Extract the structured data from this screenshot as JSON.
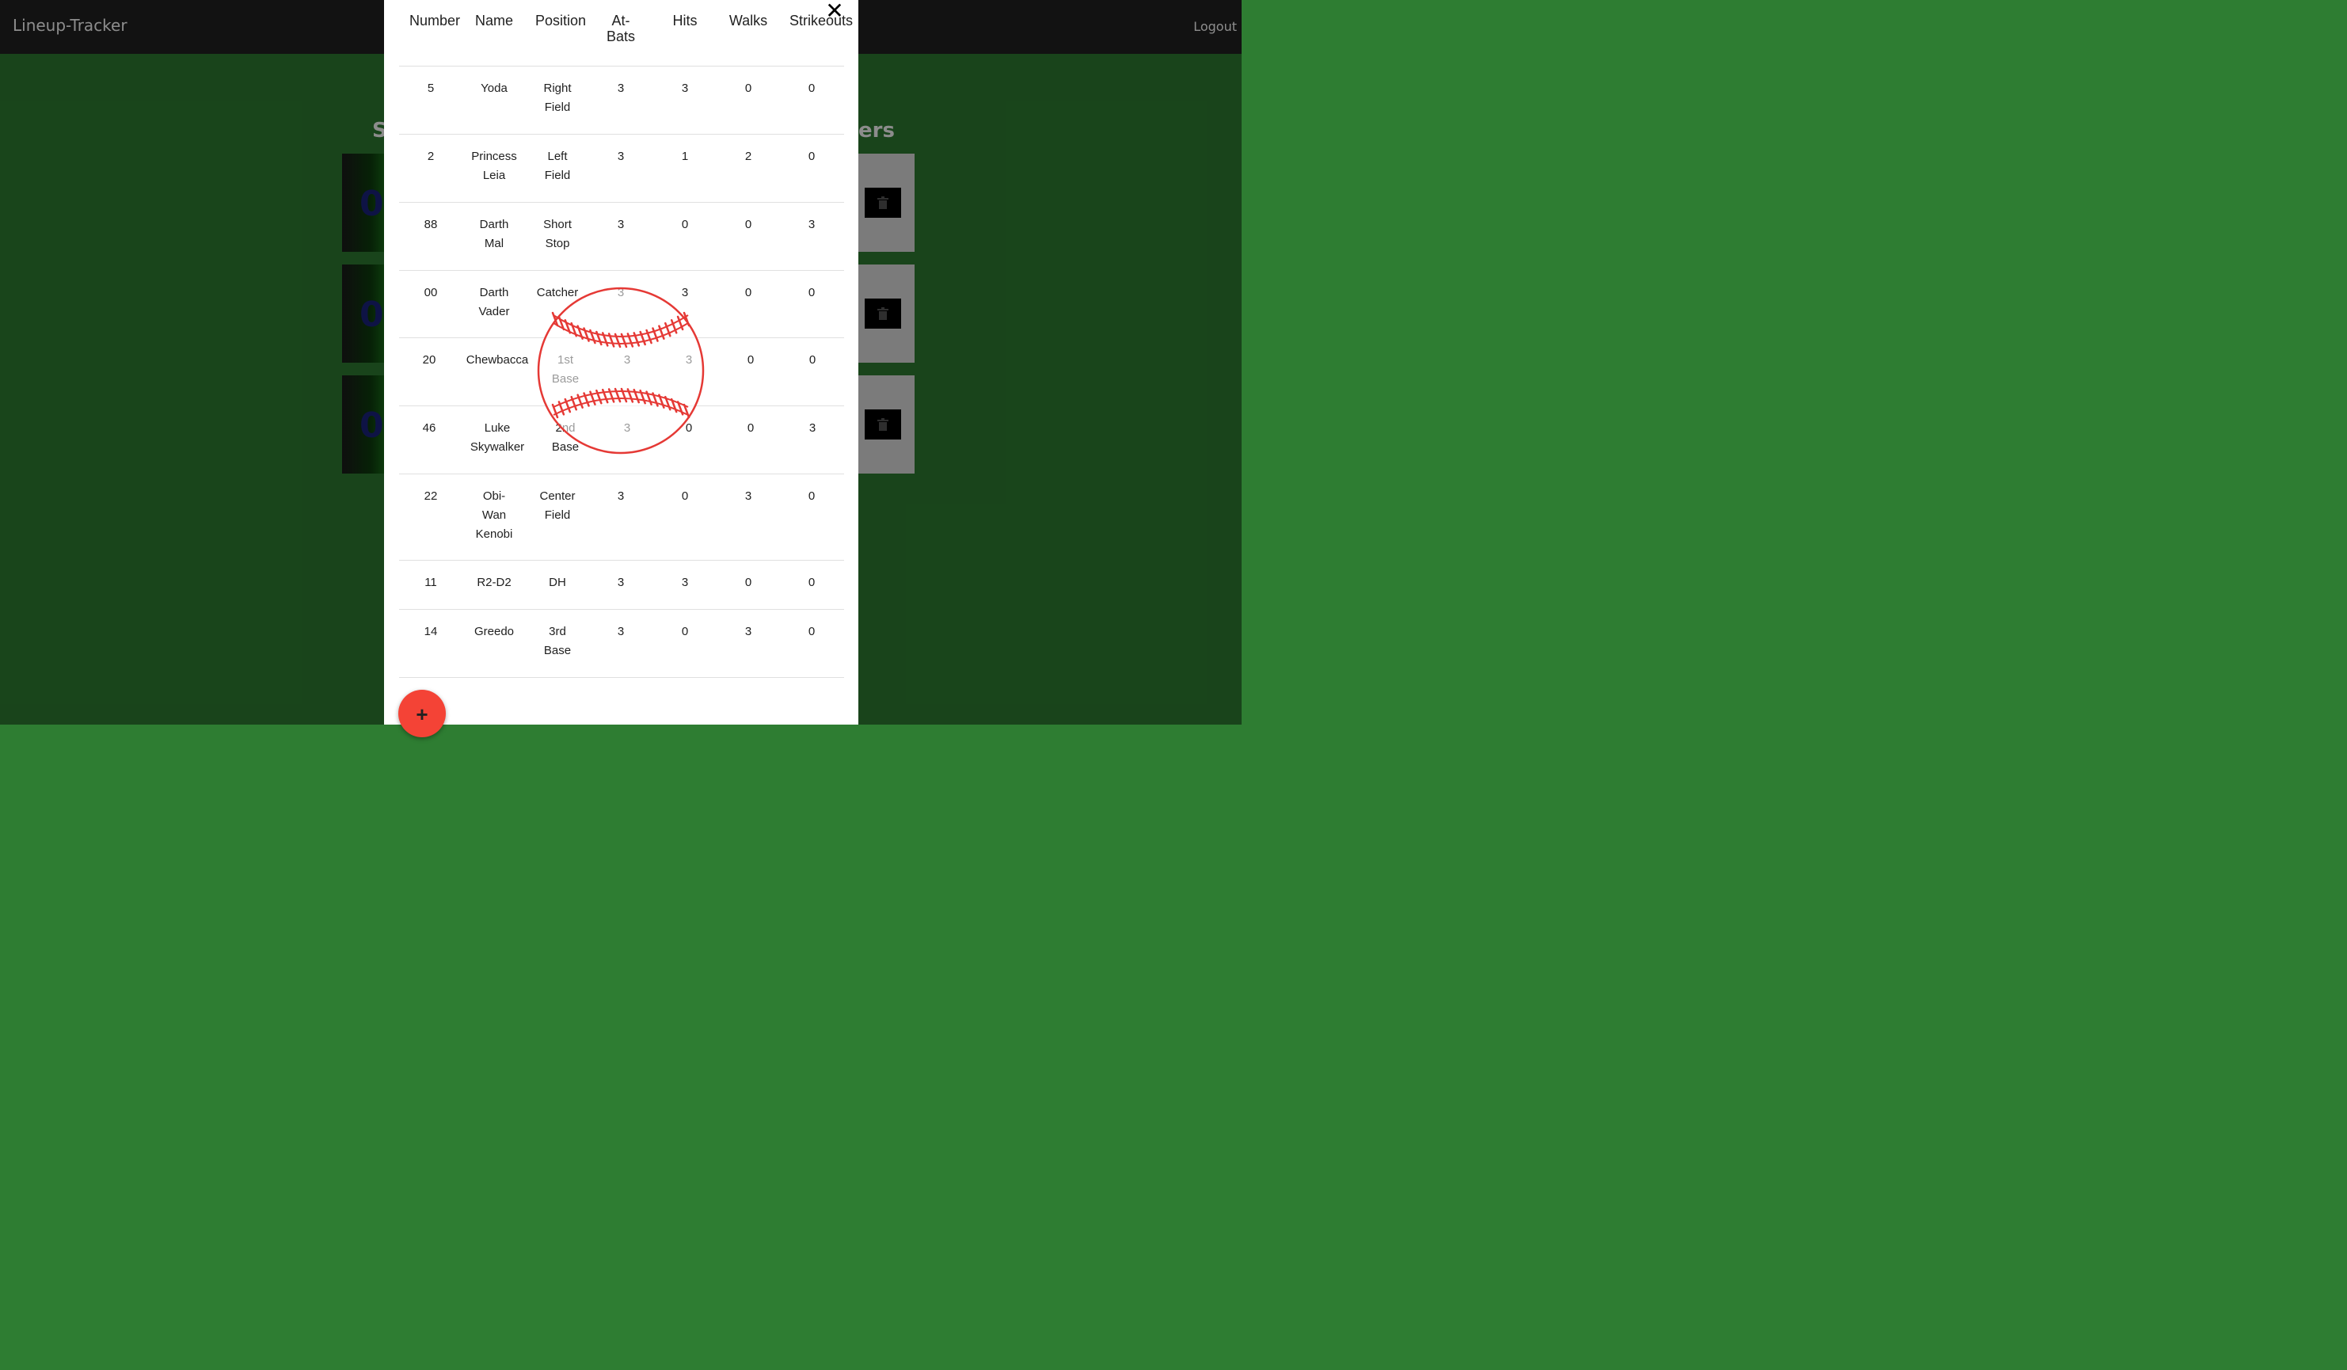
{
  "app": {
    "brand": "Lineup-Tracker",
    "logout_label": "Logout"
  },
  "background": {
    "heading_left_fragment": "S",
    "heading_right_fragment": "ers",
    "card_badge": "0"
  },
  "modal": {
    "close_label": "✕",
    "headers": {
      "number": "Number",
      "name": "Name",
      "position": "Position",
      "at_bats_1": "At-",
      "at_bats_2": "Bats",
      "hits": "Hits",
      "walks": "Walks",
      "strikeouts": "Strikeouts"
    },
    "players": [
      {
        "number": "5",
        "name": [
          "Yoda"
        ],
        "position": [
          "Right",
          "Field"
        ],
        "at_bats": "3",
        "hits": "3",
        "walks": "0",
        "strikeouts": "0"
      },
      {
        "number": "2",
        "name": [
          "Princess",
          "Leia"
        ],
        "position": [
          "Left",
          "Field"
        ],
        "at_bats": "3",
        "hits": "1",
        "walks": "2",
        "strikeouts": "0"
      },
      {
        "number": "88",
        "name": [
          "Darth",
          "Mal"
        ],
        "position": [
          "Short",
          "Stop"
        ],
        "at_bats": "3",
        "hits": "0",
        "walks": "0",
        "strikeouts": "3"
      },
      {
        "number": "00",
        "name": [
          "Darth",
          "Vader"
        ],
        "position": [
          "Catcher"
        ],
        "at_bats": "3",
        "hits": "3",
        "walks": "0",
        "strikeouts": "0"
      },
      {
        "number": "20",
        "name": [
          "Chewbacca"
        ],
        "position": [
          "1st",
          "Base"
        ],
        "at_bats": "3",
        "hits": "3",
        "walks": "0",
        "strikeouts": "0"
      },
      {
        "number": "46",
        "name": [
          "Luke",
          "Skywalker"
        ],
        "position": [
          "2nd",
          "Base"
        ],
        "at_bats": "3",
        "hits": "0",
        "walks": "0",
        "strikeouts": "3"
      },
      {
        "number": "22",
        "name": [
          "Obi-",
          "Wan",
          "Kenobi"
        ],
        "position": [
          "Center",
          "Field"
        ],
        "at_bats": "3",
        "hits": "0",
        "walks": "3",
        "strikeouts": "0"
      },
      {
        "number": "11",
        "name": [
          "R2-D2"
        ],
        "position": [
          "DH"
        ],
        "at_bats": "3",
        "hits": "3",
        "walks": "0",
        "strikeouts": "0"
      },
      {
        "number": "14",
        "name": [
          "Greedo"
        ],
        "position": [
          "3rd",
          "Base"
        ],
        "at_bats": "3",
        "hits": "0",
        "walks": "3",
        "strikeouts": "0"
      }
    ],
    "add_label": "+"
  },
  "colors": {
    "accent": "#f44336",
    "seam": "#e53935",
    "navbar": "#212121",
    "page": "#2e7d32"
  },
  "icons": {
    "close": "close-icon",
    "add": "plus-icon",
    "delete": "trash-icon",
    "spinner": "baseball-icon"
  }
}
